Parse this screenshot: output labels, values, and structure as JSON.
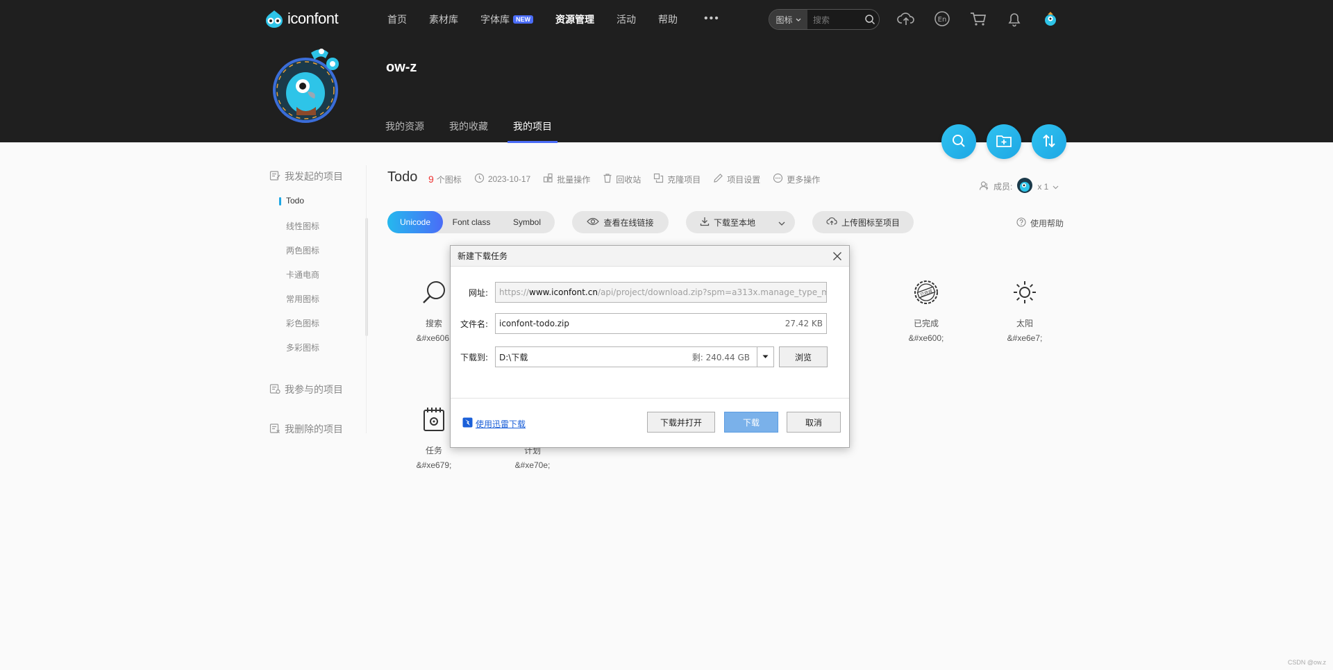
{
  "header": {
    "logo_text": "iconfont",
    "nav": [
      {
        "label": "首页",
        "active": false
      },
      {
        "label": "素材库",
        "active": false
      },
      {
        "label": "字体库",
        "active": false,
        "badge": "NEW"
      },
      {
        "label": "资源管理",
        "active": true
      },
      {
        "label": "活动",
        "active": false
      },
      {
        "label": "帮助",
        "active": false
      }
    ],
    "more_label": "•••",
    "search": {
      "scope": "图标",
      "placeholder": "搜索"
    }
  },
  "profile": {
    "username": "ow-z",
    "tabs": [
      {
        "label": "我的资源",
        "active": false
      },
      {
        "label": "我的收藏",
        "active": false
      },
      {
        "label": "我的项目",
        "active": true
      }
    ]
  },
  "sidebar": {
    "started_label": "我发起的项目",
    "projects": [
      "Todo",
      "线性图标",
      "两色图标",
      "卡通电商",
      "常用图标",
      "彩色图标",
      "多彩图标"
    ],
    "joined_label": "我参与的项目",
    "deleted_label": "我删除的项目"
  },
  "project": {
    "title": "Todo",
    "icon_count": "9",
    "icon_count_unit": "个图标",
    "date": "2023-10-17",
    "actions": [
      "批量操作",
      "回收站",
      "克隆项目",
      "项目设置",
      "更多操作"
    ],
    "members_label": "成员:",
    "members_count": "x 1",
    "modes": [
      "Unicode",
      "Font class",
      "Symbol"
    ],
    "view_online_label": "查看在线链接",
    "download_label": "下载至本地",
    "upload_label": "上传图标至项目",
    "help_label": "使用帮助"
  },
  "icons": [
    {
      "name": "搜索",
      "code": "&#xe606;",
      "icon": "search-icon"
    },
    {
      "name": "已完成",
      "code": "&#xe600;",
      "icon": "completed-stamp-icon"
    },
    {
      "name": "太阳",
      "code": "&#xe6e7;",
      "icon": "sun-icon"
    },
    {
      "name": "任务",
      "code": "&#xe679;",
      "icon": "task-icon"
    },
    {
      "name": "计划",
      "code": "&#xe70e;",
      "icon": "plan-icon"
    }
  ],
  "dialog": {
    "title": "新建下载任务",
    "url_label": "网址:",
    "url_prefix": "https://",
    "url_host": "www.iconfont.cn",
    "url_rest": "/api/project/download.zip?spm=a313x.manage_type_myp",
    "filename_label": "文件名:",
    "filename": "iconfont-todo.zip",
    "filesize": "27.42 KB",
    "dest_label": "下载到:",
    "dest_path": "D:\\下载",
    "dest_free": "剩: 240.44 GB",
    "browse_label": "浏览",
    "xunlei_label": "使用迅雷下载",
    "download_open_label": "下载并打开",
    "download_label": "下载",
    "cancel_label": "取消"
  },
  "watermark": "CSDN @ow.z"
}
